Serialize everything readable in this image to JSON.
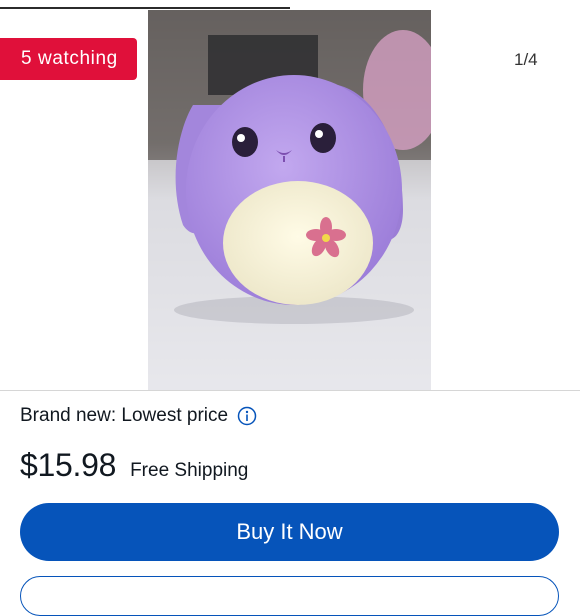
{
  "gallery": {
    "watching_badge": "5 watching",
    "image_counter": "1/4",
    "progress_fraction": 0.5
  },
  "listing": {
    "condition": "Brand new: Lowest price",
    "price": "$15.98",
    "shipping": "Free Shipping",
    "buy_label": "Buy It Now"
  },
  "colors": {
    "badge": "#e0103a",
    "primary_button": "#0654ba"
  },
  "icons": {
    "info": "info-icon"
  }
}
